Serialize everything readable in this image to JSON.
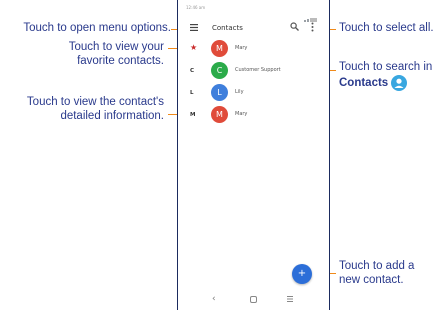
{
  "callouts": {
    "menu": "Touch to open menu options.",
    "favorites_1": "Touch to view your",
    "favorites_2": "favorite contacts.",
    "details_1": "Touch to view the contact's",
    "details_2": "detailed information.",
    "select_all": "Touch to select all.",
    "search_1": "Touch to search in",
    "search_2": "Contacts",
    "add_1": "Touch to add a",
    "add_2": "new contact."
  },
  "phone": {
    "status_time": "12:46 am",
    "title": "Contacts",
    "fab_label": "+",
    "contacts": [
      {
        "index": "★",
        "initial": "M",
        "name": "Mary",
        "color": "#e04b3a"
      },
      {
        "index": "C",
        "initial": "C",
        "name": "Customer Support",
        "color": "#2bab4a"
      },
      {
        "index": "L",
        "initial": "L",
        "name": "Lily",
        "color": "#3f7fdc"
      },
      {
        "index": "M",
        "initial": "M",
        "name": "Mary",
        "color": "#e04b3a"
      }
    ]
  },
  "colors": {
    "callout_text": "#2a3a8c",
    "leader_line": "#f08a1a",
    "fab": "#2c6ed8",
    "favorite_star": "#c92a2a"
  }
}
